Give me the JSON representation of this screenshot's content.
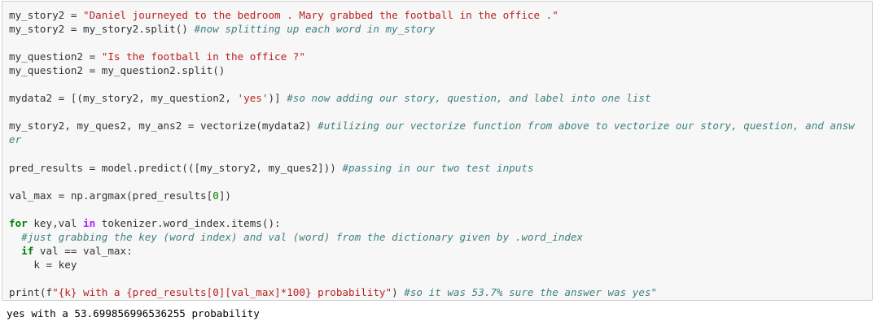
{
  "cell": {
    "lines": [
      {
        "parts": [
          [
            "n",
            "my_story2 = "
          ],
          [
            "s",
            "\"Daniel journeyed to the bedroom . Mary grabbed the football in the office .\""
          ]
        ]
      },
      {
        "parts": [
          [
            "n",
            "my_story2 = my_story2.split() "
          ],
          [
            "c",
            "#now splitting up each word in my_story"
          ]
        ]
      },
      {
        "parts": [
          [
            "n",
            ""
          ]
        ]
      },
      {
        "parts": [
          [
            "n",
            "my_question2 = "
          ],
          [
            "s",
            "\"Is the football in the office ?\""
          ]
        ]
      },
      {
        "parts": [
          [
            "n",
            "my_question2 = my_question2.split()"
          ]
        ]
      },
      {
        "parts": [
          [
            "n",
            ""
          ]
        ]
      },
      {
        "parts": [
          [
            "n",
            "mydata2 = [(my_story2, my_question2, "
          ],
          [
            "s",
            "'yes'"
          ],
          [
            "n",
            ")] "
          ],
          [
            "c",
            "#so now adding our story, question, and label into one list"
          ]
        ]
      },
      {
        "parts": [
          [
            "n",
            ""
          ]
        ]
      },
      {
        "parts": [
          [
            "n",
            "my_story2, my_ques2, my_ans2 = vectorize(mydata2) "
          ],
          [
            "c",
            "#utilizing our vectorize function from above to vectorize our story, question, and answ"
          ]
        ]
      },
      {
        "parts": [
          [
            "c",
            "er"
          ]
        ]
      },
      {
        "parts": [
          [
            "n",
            ""
          ]
        ]
      },
      {
        "parts": [
          [
            "n",
            "pred_results = model.predict(([my_story2, my_ques2])) "
          ],
          [
            "c",
            "#passing in our two test inputs"
          ]
        ]
      },
      {
        "parts": [
          [
            "n",
            ""
          ]
        ]
      },
      {
        "parts": [
          [
            "n",
            "val_max = np.argmax(pred_results["
          ],
          [
            "d",
            "0"
          ],
          [
            "n",
            "])"
          ]
        ]
      },
      {
        "parts": [
          [
            "n",
            ""
          ]
        ]
      },
      {
        "parts": [
          [
            "k",
            "for"
          ],
          [
            "n",
            " key,val "
          ],
          [
            "o",
            "in"
          ],
          [
            "n",
            " tokenizer.word_index.items():"
          ]
        ]
      },
      {
        "parts": [
          [
            "n",
            "  "
          ],
          [
            "c",
            "#just grabbing the key (word index) and val (word) from the dictionary given by .word_index"
          ]
        ]
      },
      {
        "parts": [
          [
            "n",
            "  "
          ],
          [
            "k",
            "if"
          ],
          [
            "n",
            " val == val_max:"
          ]
        ]
      },
      {
        "parts": [
          [
            "n",
            "    k = key"
          ]
        ]
      },
      {
        "parts": [
          [
            "n",
            ""
          ]
        ]
      },
      {
        "parts": [
          [
            "n",
            "print(f"
          ],
          [
            "s",
            "\"{k} with a {pred_results[0][val_max]*100} probability\""
          ],
          [
            "n",
            ") "
          ],
          [
            "c",
            "#so it was 53.7% sure the answer was yes\""
          ]
        ]
      }
    ]
  },
  "output": {
    "text": "yes with a 53.699856996536255 probability"
  }
}
